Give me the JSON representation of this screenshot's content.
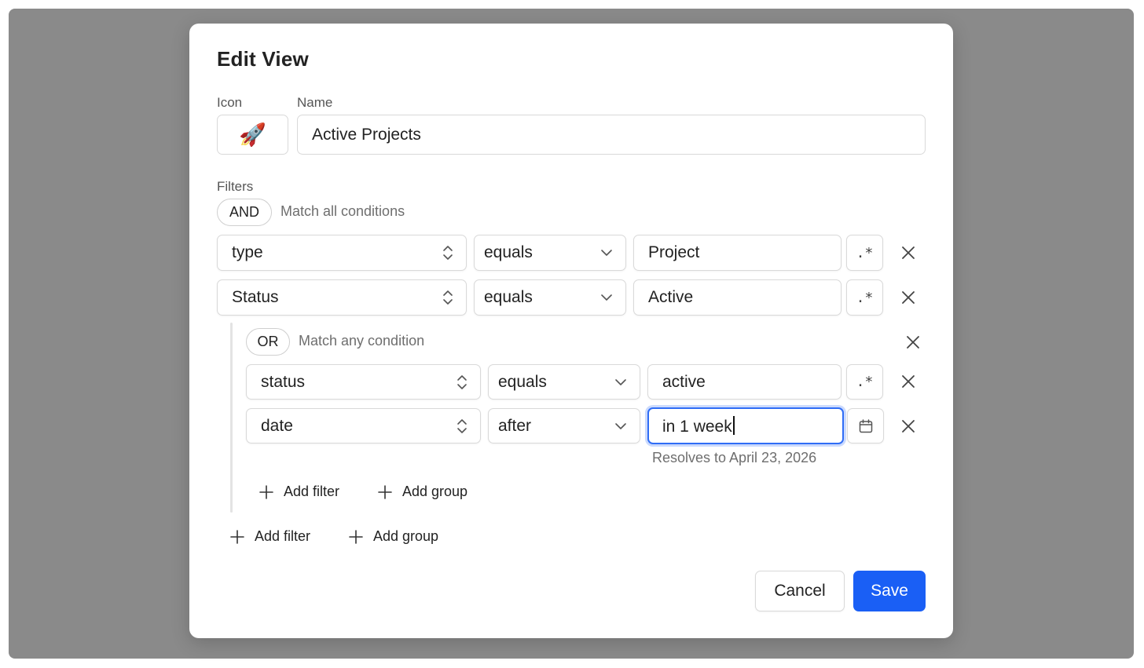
{
  "dialog": {
    "title": "Edit View",
    "icon_label": "Icon",
    "icon_value": "🚀",
    "name_label": "Name",
    "name_value": "Active Projects",
    "filters_label": "Filters"
  },
  "root_group": {
    "operator": "AND",
    "description": "Match all conditions",
    "conditions": [
      {
        "field": "type",
        "comparator": "equals",
        "value": "Project",
        "value_button": ".*"
      },
      {
        "field": "Status",
        "comparator": "equals",
        "value": "Active",
        "value_button": ".*"
      }
    ],
    "add_filter": "Add filter",
    "add_group": "Add group"
  },
  "nested_group": {
    "operator": "OR",
    "description": "Match any condition",
    "conditions": [
      {
        "field": "status",
        "comparator": "equals",
        "value": "active",
        "value_button": ".*"
      },
      {
        "field": "date",
        "comparator": "after",
        "value": "in 1 week",
        "hint": "Resolves to April 23, 2026"
      }
    ],
    "add_filter": "Add filter",
    "add_group": "Add group"
  },
  "footer": {
    "cancel_label": "Cancel",
    "save_label": "Save"
  },
  "colors": {
    "primary": "#1a5ff5",
    "overlay": "#8a8a8a",
    "focus": "#2f6df6"
  }
}
